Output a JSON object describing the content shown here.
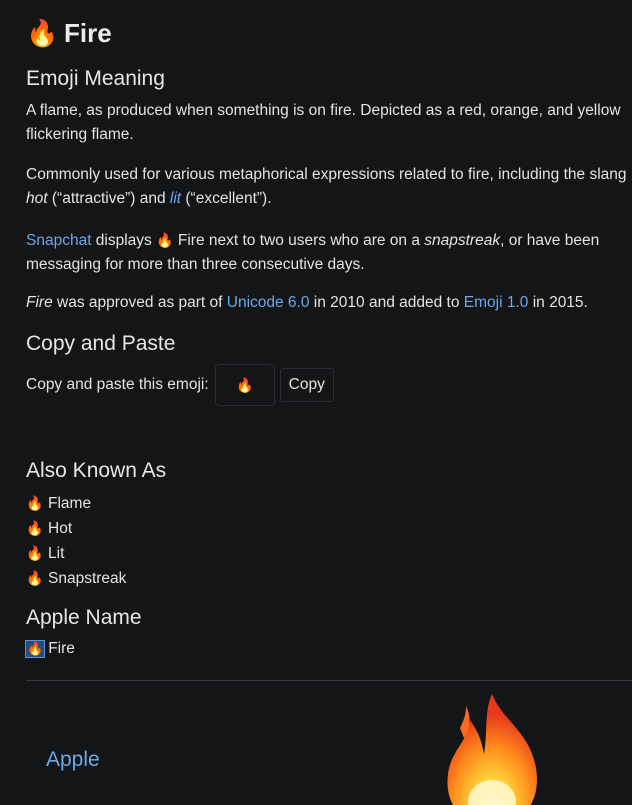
{
  "header": {
    "emoji": "🔥",
    "title": "Fire"
  },
  "meaning": {
    "heading": "Emoji Meaning",
    "p1_line1": "A flame, as produced when something is on fire. Depicted as a red, orange, and yellow",
    "p1_line2": "flickering flame.",
    "p2_line1": "Commonly used for various metaphorical expressions related to fire, including the slang",
    "p2_hot": "hot",
    "p2_hot_gloss": " (“attractive”) and ",
    "p2_lit": "lit",
    "p2_lit_gloss": " (“excellent”).",
    "p3_snapchat": "Snapchat",
    "p3_displays": " displays ",
    "p3_emoji": "🔥",
    "p3_mid": " Fire next to two users who are on a ",
    "p3_snapstreak": "snapstreak",
    "p3_end": ", or have been",
    "p3_line2": "messaging for more than three consecutive days.",
    "p4_fire": "Fire",
    "p4_a": " was approved as part of ",
    "p4_unicode": "Unicode 6.0",
    "p4_b": " in 2010 and added to ",
    "p4_emoji": "Emoji 1.0",
    "p4_c": " in 2015."
  },
  "copy": {
    "heading": "Copy and Paste",
    "label": "Copy and paste this emoji:",
    "emoji": "🔥",
    "button": "Copy"
  },
  "aka": {
    "heading": "Also Known As",
    "items": [
      {
        "emoji": "🔥",
        "label": "Flame"
      },
      {
        "emoji": "🔥",
        "label": "Hot"
      },
      {
        "emoji": "🔥",
        "label": "Lit"
      },
      {
        "emoji": "🔥",
        "label": "Snapstreak"
      }
    ]
  },
  "apple_name": {
    "heading": "Apple Name",
    "emoji": "🔥",
    "label": "Fire"
  },
  "vendor": {
    "name": "Apple",
    "image_icon": "fire-icon"
  },
  "colors": {
    "link": "#6ca8e6",
    "background": "#141517",
    "text": "#e3e3e3"
  }
}
